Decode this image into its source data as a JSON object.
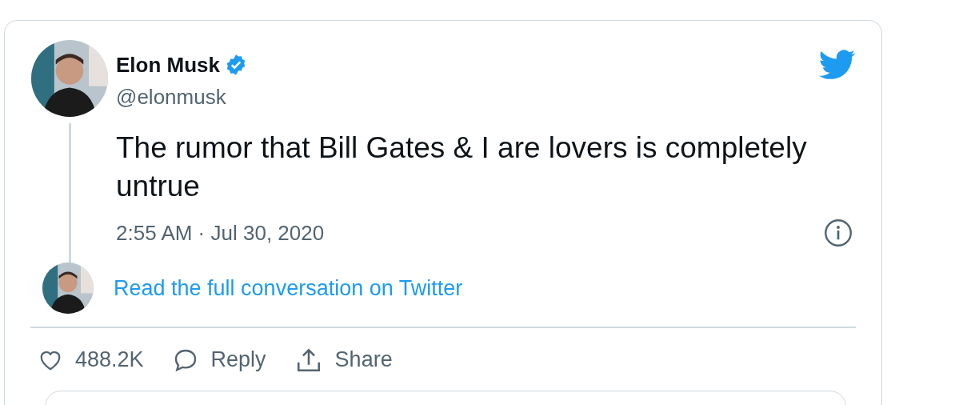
{
  "author": {
    "name": "Elon Musk",
    "verified": true,
    "handle": "@elonmusk"
  },
  "tweet": {
    "text": "The rumor that Bill Gates & I are lovers is completely untrue",
    "timestamp": "2:55 AM · Jul 30, 2020"
  },
  "conversation_link": "Read the full conversation on Twitter",
  "actions": [
    {
      "kind": "like",
      "label": "488.2K"
    },
    {
      "kind": "reply",
      "label": "Reply"
    },
    {
      "kind": "share",
      "label": "Share"
    }
  ]
}
